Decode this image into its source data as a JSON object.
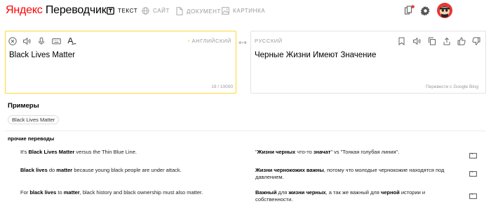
{
  "header": {
    "logo_brand": "Яндекс",
    "logo_product": "Переводчик",
    "tabs": [
      {
        "label": "ТЕКСТ"
      },
      {
        "label": "САЙТ"
      },
      {
        "label": "ДОКУМЕНТ"
      },
      {
        "label": "КАРТИНКА"
      }
    ]
  },
  "source": {
    "language": "АНГЛИЙСКИЙ",
    "text": "Black Lives Matter",
    "counter": "19 / 10000"
  },
  "target": {
    "language": "РУССКИЙ",
    "text": "Черные Жизни Имеют Значение",
    "attribution": "Перевести с Google Bing"
  },
  "examples": {
    "title": "Примеры",
    "chip": "Black Lives Matter"
  },
  "other_translations": {
    "title": "прочие переводы",
    "rows": [
      {
        "src": [
          {
            "t": "It's ",
            "b": false
          },
          {
            "t": "Black Lives Matter",
            "b": true
          },
          {
            "t": " versus the Thin Blue Line.",
            "b": false
          }
        ],
        "dst": [
          {
            "t": "\"",
            "b": false
          },
          {
            "t": "Жизни черных",
            "b": true
          },
          {
            "t": " что-то ",
            "b": false
          },
          {
            "t": "значат",
            "b": true
          },
          {
            "t": "\" vs \"Тонкая голубая линия\".",
            "b": false
          }
        ]
      },
      {
        "src": [
          {
            "t": "Black lives",
            "b": true
          },
          {
            "t": " do ",
            "b": false
          },
          {
            "t": "matter",
            "b": true
          },
          {
            "t": " because young black people are under attack.",
            "b": false
          }
        ],
        "dst": [
          {
            "t": "Жизни чернокожих важны",
            "b": true
          },
          {
            "t": ", потому что молодые чернокожие находятся под давлением.",
            "b": false
          }
        ]
      },
      {
        "src": [
          {
            "t": "For ",
            "b": false
          },
          {
            "t": "black lives",
            "b": true
          },
          {
            "t": " to ",
            "b": false
          },
          {
            "t": "matter",
            "b": true
          },
          {
            "t": ", black history and black ownership must also matter.",
            "b": false
          }
        ],
        "dst": [
          {
            "t": "Важный",
            "b": true
          },
          {
            "t": " для ",
            "b": false
          },
          {
            "t": "жизни черных",
            "b": true
          },
          {
            "t": ", а так же важный для ",
            "b": false
          },
          {
            "t": "черной",
            "b": true
          },
          {
            "t": " истории и собственности.",
            "b": false
          }
        ]
      }
    ]
  },
  "colors": {
    "accent": "#fdd835",
    "brand_red": "#ff0000",
    "badge": "#e53935"
  },
  "icons": [
    "text-icon",
    "globe-icon",
    "document-icon",
    "image-icon",
    "bookmarks-icon",
    "gear-icon",
    "avatar",
    "clear-icon",
    "speaker-icon",
    "microphone-icon",
    "keyboard-icon",
    "spellcheck-icon",
    "swap-icon",
    "bookmark-icon",
    "copy-icon",
    "share-icon",
    "thumbs-up-icon",
    "thumbs-down-icon"
  ]
}
